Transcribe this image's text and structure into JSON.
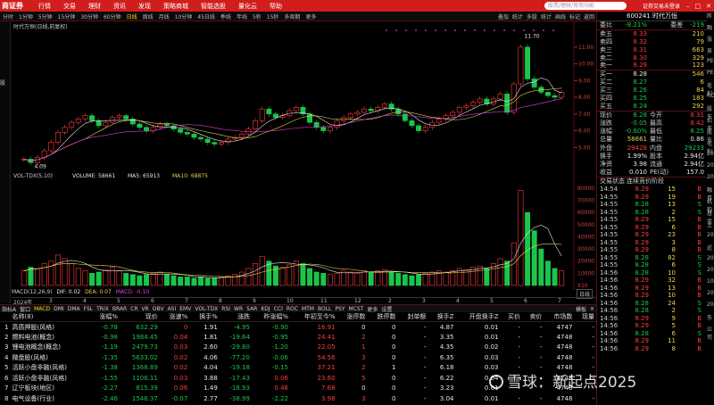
{
  "titlebar": {
    "brand": "商证券",
    "menus": [
      "行情",
      "交易",
      "理财",
      "资讯",
      "发现",
      "策略商城",
      "智能选股",
      "量化云",
      "帮助"
    ],
    "search_placeholder": "股票/理财/常用功能",
    "login": "证券交易未登录",
    "window_controls": [
      "–",
      "□",
      "✕"
    ]
  },
  "toolbar": {
    "periods": [
      "分时",
      "1分钟",
      "5分钟",
      "15分钟",
      "30分钟",
      "60分钟",
      "日线",
      "周线",
      "月线",
      "10分钟",
      "45日线",
      "季线",
      "年线",
      "5秒",
      "15秒",
      "多周期"
    ],
    "active_period": "日线",
    "more": "更多",
    "tools": [
      "叠加",
      "统计",
      "多股",
      "统计",
      "画线",
      "标记",
      "返回"
    ]
  },
  "left_label": "股",
  "price_chart": {
    "label": "时代万恒(日线,前复权)",
    "y_ticks": [
      "11.00",
      "10.00",
      "9.00",
      "8.00",
      "7.00",
      "6.00",
      "5.00"
    ],
    "high_label": "11.70",
    "low_label": "4.09",
    "prices": [
      4.3,
      4.09,
      4.4,
      4.8,
      5.3,
      5.9,
      6.2,
      6.5,
      6.7,
      6.9,
      6.6,
      6.3,
      6.5,
      6.8,
      6.9,
      6.7,
      6.4,
      6.2,
      6.0,
      6.2,
      6.4,
      6.3,
      6.1,
      5.9,
      5.8,
      5.6,
      5.5,
      5.3,
      5.2,
      5.3,
      5.5,
      5.6,
      5.8,
      6.1,
      6.6,
      7.3,
      7.0,
      6.8,
      6.9,
      7.2,
      7.4,
      7.0,
      6.5,
      6.2,
      6.0,
      6.2,
      6.6,
      6.8,
      7.0,
      7.1,
      7.3,
      7.2,
      7.4,
      7.6,
      7.3,
      7.0,
      6.6,
      6.3,
      6.0,
      6.2,
      6.5,
      6.7,
      6.9,
      7.1,
      7.4,
      7.5,
      7.7,
      7.9,
      7.6,
      7.9,
      8.2,
      7.1,
      8.8,
      11.0,
      9.1,
      8.6,
      8.3,
      8.1,
      8.0,
      8.29
    ]
  },
  "vol_chart": {
    "label": "VOL-TDX(5,10)",
    "volume_label": "VOLUME: 58661",
    "ma5_label": "MA5: 65913",
    "ma10_label": "MA10: 68875",
    "y_ticks": [
      "80000",
      "70000",
      "60000",
      "50000",
      "40000",
      "30000",
      "20000",
      "10000"
    ],
    "unit": "X10",
    "volumes": [
      12,
      15,
      14,
      18,
      20,
      25,
      22,
      18,
      14,
      12,
      10,
      11,
      13,
      15,
      12,
      10,
      9,
      8,
      9,
      10,
      11,
      9,
      8,
      7,
      7,
      6,
      7,
      6,
      6,
      7,
      8,
      9,
      11,
      14,
      18,
      24,
      20,
      16,
      15,
      17,
      20,
      18,
      14,
      11,
      10,
      9,
      10,
      12,
      11,
      10,
      12,
      11,
      12,
      13,
      11,
      10,
      9,
      8,
      9,
      10,
      11,
      12,
      11,
      12,
      14,
      13,
      15,
      16,
      14,
      18,
      22,
      20,
      35,
      78,
      60,
      45,
      30,
      20,
      14,
      12
    ],
    "markers": [
      "融",
      "财",
      "融"
    ]
  },
  "macd": {
    "label": "MACD(12,26,9)",
    "dif": "DIF: 0.02",
    "dea": "DEA: 0.07",
    "macd": "MACD: -0.10",
    "mode": "日线"
  },
  "axis": {
    "year": "2024年",
    "months": [
      "3",
      "4",
      "5",
      "6",
      "7",
      "8",
      "9",
      "10",
      "11",
      "12",
      "2",
      "3",
      "4",
      "5",
      "6",
      "7"
    ]
  },
  "tabs": {
    "items": [
      "指标A",
      "窗口",
      "MACD",
      "DMI",
      "DMA",
      "FSL",
      "TRIX",
      "BRAR",
      "CR",
      "VR",
      "OBV",
      "ASI",
      "EMV",
      "VOL-TDX",
      "RSI",
      "WR",
      "SAR",
      "KDJ",
      "CCI",
      "ROC",
      "MTM",
      "BOLL",
      "PSY",
      "MCST",
      "更多",
      "设置"
    ],
    "active": "MACD",
    "right": [
      "模板",
      "✕"
    ]
  },
  "table": {
    "headers": [
      "",
      "名称(8)",
      "涨幅%",
      "现价",
      "涨速%",
      "换手%",
      "涨跌",
      "昨涨幅%",
      "年初至今%",
      "涨停数",
      "跌停数",
      "封单额",
      "换手Z",
      "开盘换手Z",
      "买价",
      "卖价",
      "市场数",
      "现量"
    ],
    "rows": [
      [
        "1",
        "高质押股(风格)",
        "-0.78",
        "632.29",
        "0",
        "1.91",
        "-4.95",
        "-0.90",
        "16.91",
        "0",
        "0",
        "-",
        "4.87",
        "0.01",
        "-",
        "-",
        "4747",
        "-"
      ],
      [
        "2",
        "燃料电池(概念)",
        "-0.98",
        "1984.45",
        "0.04",
        "1.81",
        "-19.64",
        "-0.95",
        "24.41",
        "2",
        "0",
        "-",
        "3.35",
        "0.01",
        "-",
        "-",
        "4748",
        "-"
      ],
      [
        "3",
        "锂电池概念(概念)",
        "-1.19",
        "2479.73",
        "0.03",
        "2.60",
        "-29.80",
        "-1.20",
        "22.05",
        "1",
        "0",
        "-",
        "4.35",
        "0.02",
        "-",
        "-",
        "4748",
        "-"
      ],
      [
        "4",
        "微盘股(风格)",
        "-1.35",
        "5633.02",
        "0.02",
        "4.06",
        "-77.20",
        "-0.06",
        "54.56",
        "3",
        "0",
        "-",
        "6.35",
        "0.03",
        "-",
        "-",
        "4748",
        "-"
      ],
      [
        "5",
        "活跃小盘非融(风格)",
        "-1.38",
        "1368.89",
        "0.02",
        "4.04",
        "-19.18",
        "-0.15",
        "37.21",
        "2",
        "1",
        "-",
        "6.18",
        "0.03",
        "-",
        "-",
        "4748",
        "-"
      ],
      [
        "6",
        "活跃小盘非融(风格)",
        "-1.55",
        "1106.11",
        "0.03",
        "3.88",
        "-17.43",
        "0.06",
        "23.60",
        "5",
        "0",
        "-",
        "6.22",
        "0.04",
        "-",
        "-",
        "4748",
        "-"
      ],
      [
        "7",
        "辽宁板块(地区)",
        "-2.27",
        "815.39",
        "0.06",
        "1.49",
        "-18.93",
        "0.46",
        "7.68",
        "0",
        "0",
        "-",
        "3.23",
        "0.01",
        "-",
        "-",
        "4748",
        "-"
      ],
      [
        "8",
        "电气设备(行业)",
        "-2.46",
        "1546.37",
        "-0.07",
        "2.77",
        "-38.99",
        "-2.22",
        "3.98",
        "3",
        "0",
        "-",
        "3.04",
        "0.01",
        "-",
        "-",
        "4748",
        "-"
      ]
    ]
  },
  "quote": {
    "header": "600241 时代万恒",
    "weibi_label": "委比",
    "weibi": "-8.21%",
    "weicha_label": "委差",
    "weicha": "-219",
    "asks": [
      [
        "卖五",
        "8.33",
        "210"
      ],
      [
        "卖四",
        "8.32",
        "79"
      ],
      [
        "卖三",
        "8.31",
        "663"
      ],
      [
        "卖二",
        "8.30",
        "329"
      ],
      [
        "卖一",
        "8.29",
        "123"
      ]
    ],
    "bids": [
      [
        "买一",
        "8.28",
        "546"
      ],
      [
        "买二",
        "8.27",
        "6"
      ],
      [
        "买三",
        "8.26",
        "84"
      ],
      [
        "买四",
        "8.25",
        "183"
      ],
      [
        "买五",
        "8.24",
        "292"
      ]
    ],
    "stats": [
      [
        "现价",
        "8.28",
        "今开",
        "8.31"
      ],
      [
        "涨跌",
        "-0.05",
        "最高",
        "8.42"
      ],
      [
        "涨幅",
        "-0.60%",
        "最低",
        "8.25"
      ],
      [
        "总量",
        "58661",
        "量比",
        "0.86"
      ],
      [
        "外盘",
        "29428",
        "内盘",
        "29233"
      ],
      [
        "换手",
        "1.99%",
        "股本",
        "2.94亿"
      ],
      [
        "净资",
        "3.98",
        "流通",
        "2.94亿"
      ],
      [
        "收益",
        "0.010",
        "PE(动)",
        "157.0"
      ]
    ],
    "trade_label": "交易状态",
    "trade_status": "连续竞价阶段",
    "trades": [
      [
        "14:54",
        "8.29",
        "15",
        "B"
      ],
      [
        "14:55",
        "8.29",
        "19",
        "B"
      ],
      [
        "14:55",
        "8.28",
        "13",
        "S"
      ],
      [
        "14:55",
        "8.28",
        "2",
        "S"
      ],
      [
        "14:55",
        "8.29",
        "15",
        "B"
      ],
      [
        "14:55",
        "8.29",
        "6",
        "B"
      ],
      [
        "14:55",
        "8.29",
        "23",
        "B"
      ],
      [
        "14:55",
        "8.29",
        "3",
        "B"
      ],
      [
        "14:55",
        "8.29",
        "8",
        "B"
      ],
      [
        "14:55",
        "8.28",
        "82",
        "S"
      ],
      [
        "14:55",
        "8.28",
        "6",
        "S"
      ],
      [
        "14:56",
        "8.28",
        "10",
        "S"
      ],
      [
        "14:56",
        "8.29",
        "32",
        "B"
      ],
      [
        "14:56",
        "8.29",
        "13",
        "B"
      ],
      [
        "14:56",
        "8.29",
        "10",
        "B"
      ],
      [
        "14:56",
        "8.28",
        "24",
        "S"
      ],
      [
        "14:56",
        "8.28",
        "2",
        "S"
      ],
      [
        "14:56",
        "8.29",
        "9",
        "B"
      ],
      [
        "14:56",
        "8.29",
        "5",
        "B"
      ],
      [
        "14:56",
        "8.28",
        "6",
        "S"
      ],
      [
        "14:56",
        "8.29",
        "11",
        "B"
      ],
      [
        "14:56",
        "8.29",
        "8",
        "B"
      ]
    ]
  },
  "edge": [
    "昨",
    "融",
    "涨",
    "吴",
    "PEG",
    "PE(",
    "毛利",
    "ROE",
    "股东",
    "扣非",
    "股东",
    "毛利",
    "20",
    "20",
    "20",
    "融券",
    "机构",
    "基金",
    "主",
    "20",
    "近",
    "20",
    "20",
    "10",
    "20",
    "20",
    "东",
    "公司"
  ],
  "watermark": "雪球：新起点2025",
  "colors": {
    "up": "#ff3b3b",
    "down": "#19c64b",
    "title": "#d21d1d",
    "gold": "#ffd700"
  }
}
